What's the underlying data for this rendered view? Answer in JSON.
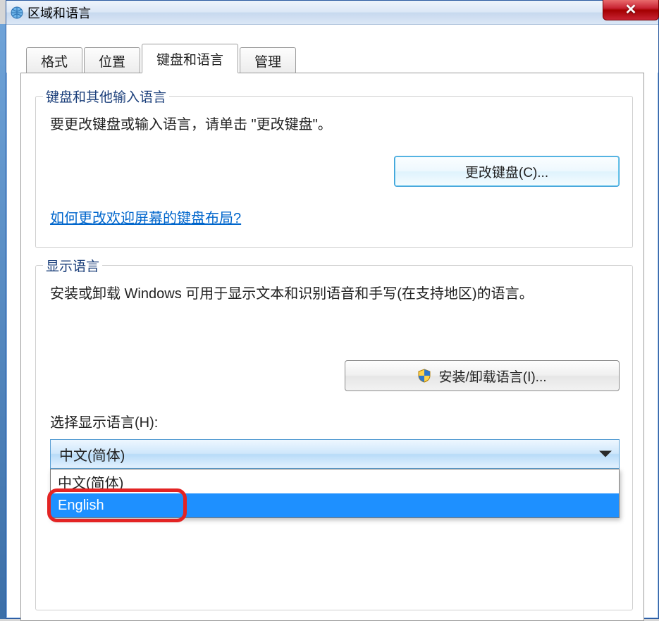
{
  "window": {
    "title": "区域和语言"
  },
  "tabs": {
    "format": "格式",
    "location": "位置",
    "keyboard_language": "键盘和语言",
    "admin": "管理"
  },
  "group_keyboard": {
    "legend": "键盘和其他输入语言",
    "desc": "要更改键盘或输入语言，请单击 \"更改键盘\"。",
    "change_keyboard_btn": "更改键盘(C)...",
    "link": "如何更改欢迎屏幕的键盘布局?"
  },
  "group_display": {
    "legend": "显示语言",
    "desc": "安装或卸载 Windows 可用于显示文本和识别语音和手写(在支持地区)的语言。",
    "install_btn": "安装/卸载语言(I)...",
    "select_label": "选择显示语言(H):",
    "selected": "中文(简体)",
    "options": [
      "中文(简体)",
      "English"
    ]
  }
}
